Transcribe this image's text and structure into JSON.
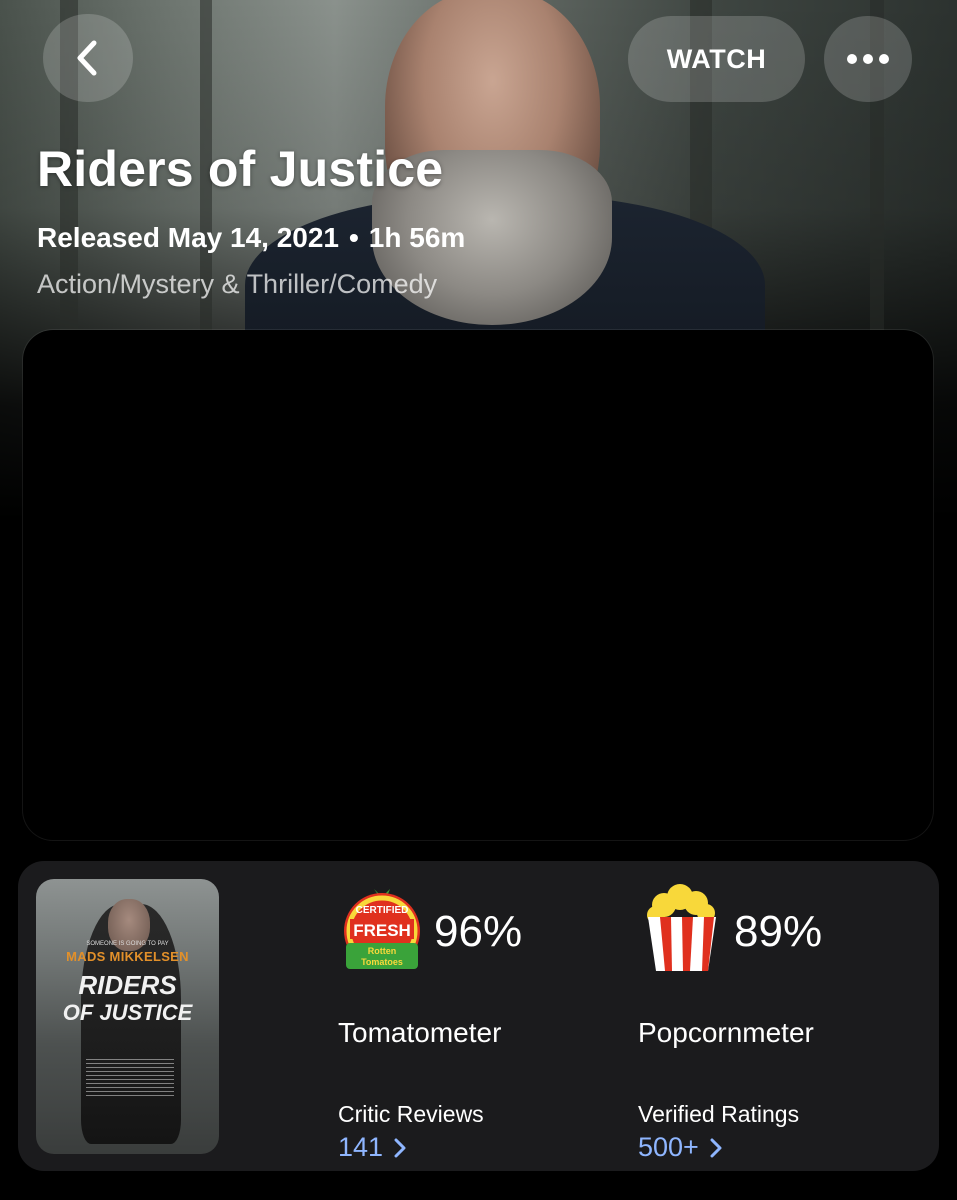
{
  "header": {
    "watch_label": "WATCH",
    "back_icon": "chevron-left-icon",
    "more_icon": "more-dots-icon"
  },
  "movie": {
    "title": "Riders of Justice",
    "released": "Released May 14, 2021",
    "separator": "•",
    "runtime": "1h 56m",
    "genres": "Action/Mystery & Thriller/Comedy"
  },
  "poster": {
    "kicker": "SOMEONE IS GOING TO PAY",
    "actor": "MADS MIKKELSEN",
    "title_line1": "RIDERS",
    "title_line2": "OF JUSTICE"
  },
  "scores": {
    "tomatometer": {
      "value": "96%",
      "label": "Tomatometer",
      "sub_label": "Critic Reviews",
      "count": "141",
      "badge_top": "CERTIFIED",
      "badge_mid": "FRESH",
      "badge_brand_1": "Rotten",
      "badge_brand_2": "Tomatoes"
    },
    "popcornmeter": {
      "value": "89%",
      "label": "Popcornmeter",
      "sub_label": "Verified Ratings",
      "count": "500+"
    }
  },
  "colors": {
    "link": "#8fb6ff",
    "card_bg": "#1b1b1d",
    "tomato_red": "#e0301e",
    "popcorn_yellow": "#f8d83a"
  }
}
